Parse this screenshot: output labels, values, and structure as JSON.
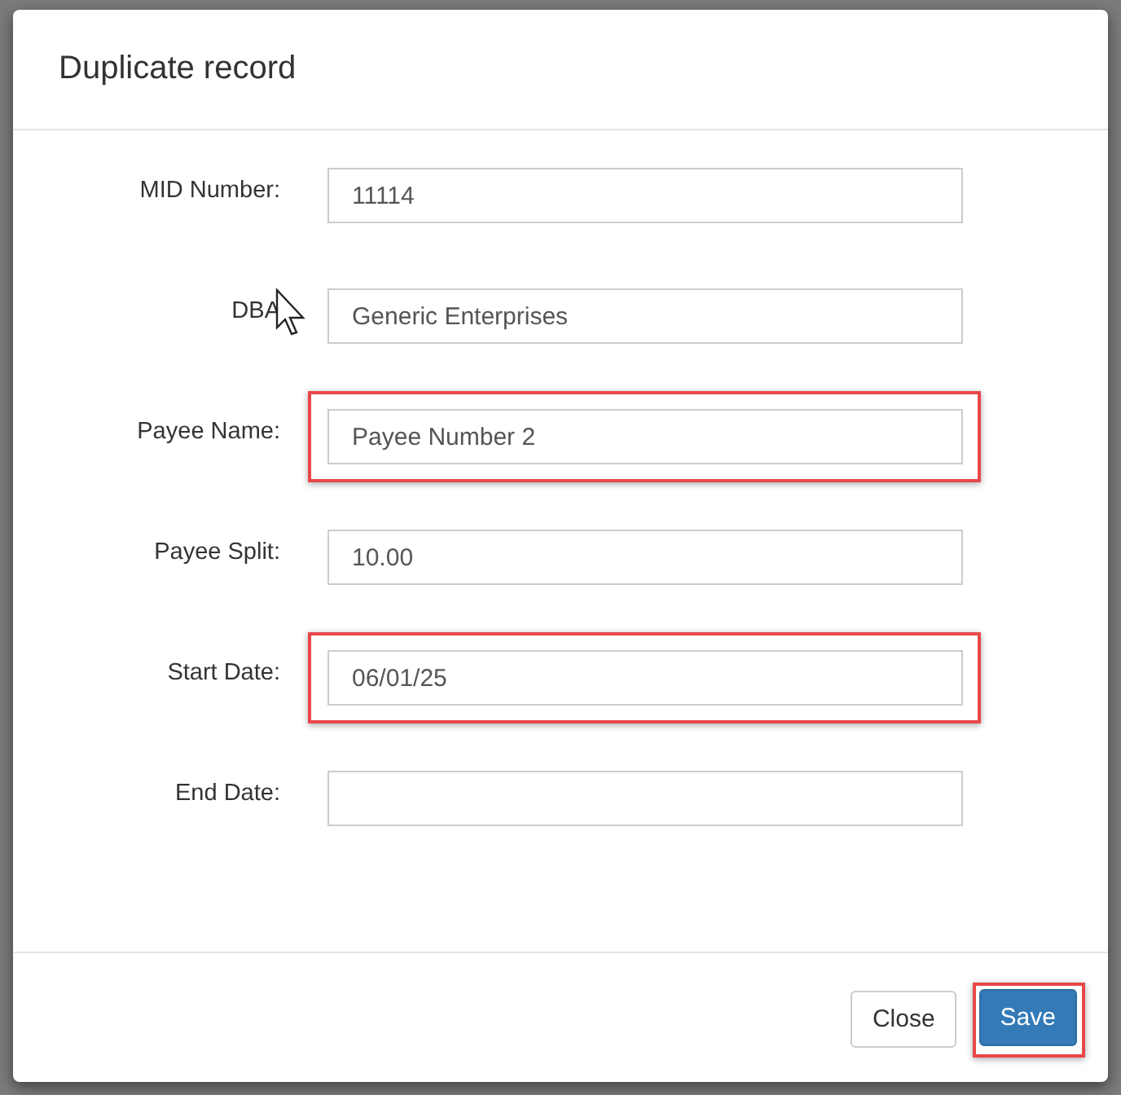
{
  "dialog": {
    "title": "Duplicate record",
    "fields": [
      {
        "label": "MID Number:",
        "value": "11114",
        "highlighted": false
      },
      {
        "label": "DBA",
        "value": "Generic Enterprises",
        "highlighted": false
      },
      {
        "label": "Payee Name:",
        "value": "Payee Number 2",
        "highlighted": true
      },
      {
        "label": "Payee Split:",
        "value": "10.00",
        "highlighted": false
      },
      {
        "label": "Start Date:",
        "value": "06/01/25",
        "highlighted": true
      },
      {
        "label": "End Date:",
        "highlighted": false
      }
    ],
    "buttons": [
      {
        "label": "Close",
        "kind": "default",
        "highlighted": false
      },
      {
        "label": "Save",
        "kind": "primary",
        "highlighted": true
      }
    ]
  }
}
